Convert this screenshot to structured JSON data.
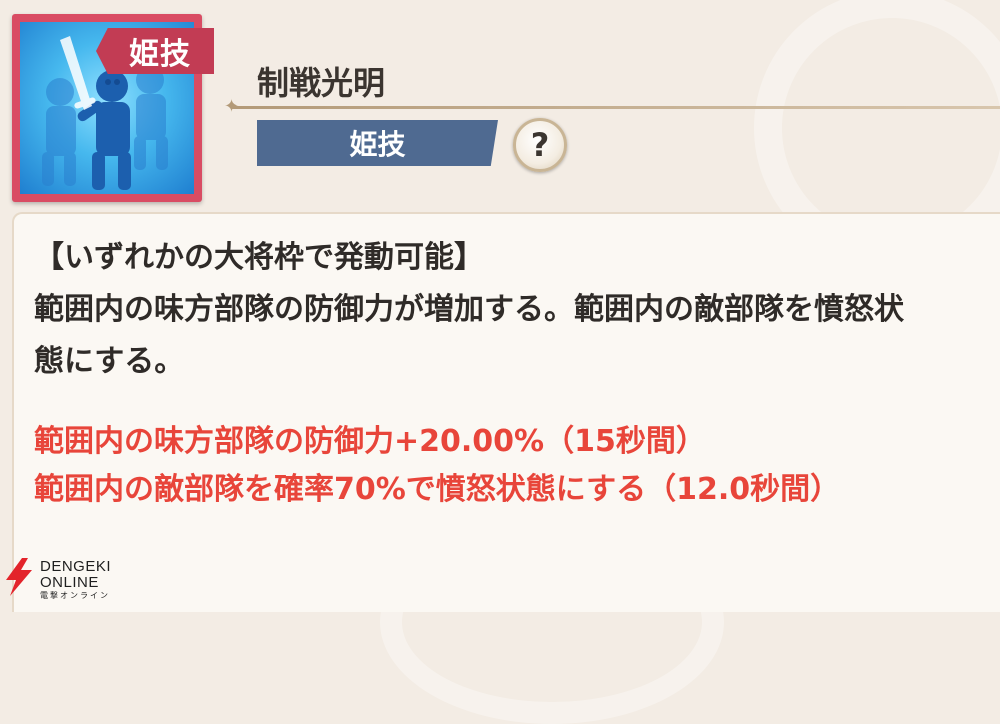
{
  "skill": {
    "icon_name": "sword-warriors-icon",
    "ribbon_label": "姫技",
    "name": "制戦光明",
    "type_label": "姫技",
    "help_label": "?"
  },
  "description": {
    "lines": [
      "【いずれかの大将枠で発動可能】",
      "範囲内の味方部隊の防御力が増加する。範囲内の敵部隊を憤怒状",
      "態にする。"
    ]
  },
  "effects": [
    "範囲内の味方部隊の防御力+20.00%（15秒間）",
    "範囲内の敵部隊を確率70%で憤怒状態にする（12.0秒間）"
  ],
  "watermark": {
    "line1": "DENGEKI",
    "line2": "ONLINE",
    "line3": "電撃オンライン"
  },
  "colors": {
    "icon_frame": "#d94c63",
    "ribbon": "#c23c54",
    "type_badge": "#4f6a91",
    "effect_text": "#e8453a"
  }
}
